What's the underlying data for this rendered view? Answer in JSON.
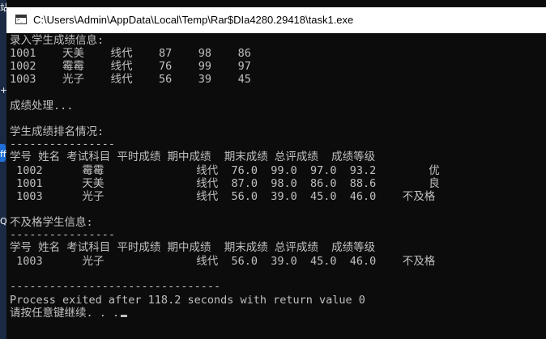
{
  "desktop": {
    "fragments": [
      "站",
      "++",
      "ffic",
      "Q"
    ]
  },
  "window": {
    "title": "C:\\Users\\Admin\\AppData\\Local\\Temp\\Rar$DIa4280.29418\\task1.exe",
    "icon": "console-app-icon"
  },
  "console": {
    "lines": [
      "录入学生成绩信息:",
      "1001    天美    线代    87    98    86",
      "1002    霉霉    线代    76    99    97",
      "1003    光子    线代    56    39    45",
      "",
      "成绩处理...",
      "",
      "学生成绩排名情况:",
      "----------------",
      "学号 姓名 考试科目 平时成绩 期中成绩  期末成绩 总评成绩  成绩等级",
      " 1002      霉霉              线代  76.0  99.0  97.0  93.2        优",
      " 1001      天美              线代  87.0  98.0  86.0  88.6        良",
      " 1003      光子              线代  56.0  39.0  45.0  46.0    不及格",
      "",
      "不及格学生信息:",
      "----------------",
      "学号 姓名 考试科目 平时成绩 期中成绩  期末成绩 总评成绩  成绩等级",
      " 1003      光子              线代  56.0  39.0  45.0  46.0    不及格",
      "",
      "--------------------------------",
      "Process exited after 118.2 seconds with return value 0",
      "请按任意键继续. . ."
    ],
    "text_color": "#c0c0c0",
    "background": "#0c0c0c"
  }
}
